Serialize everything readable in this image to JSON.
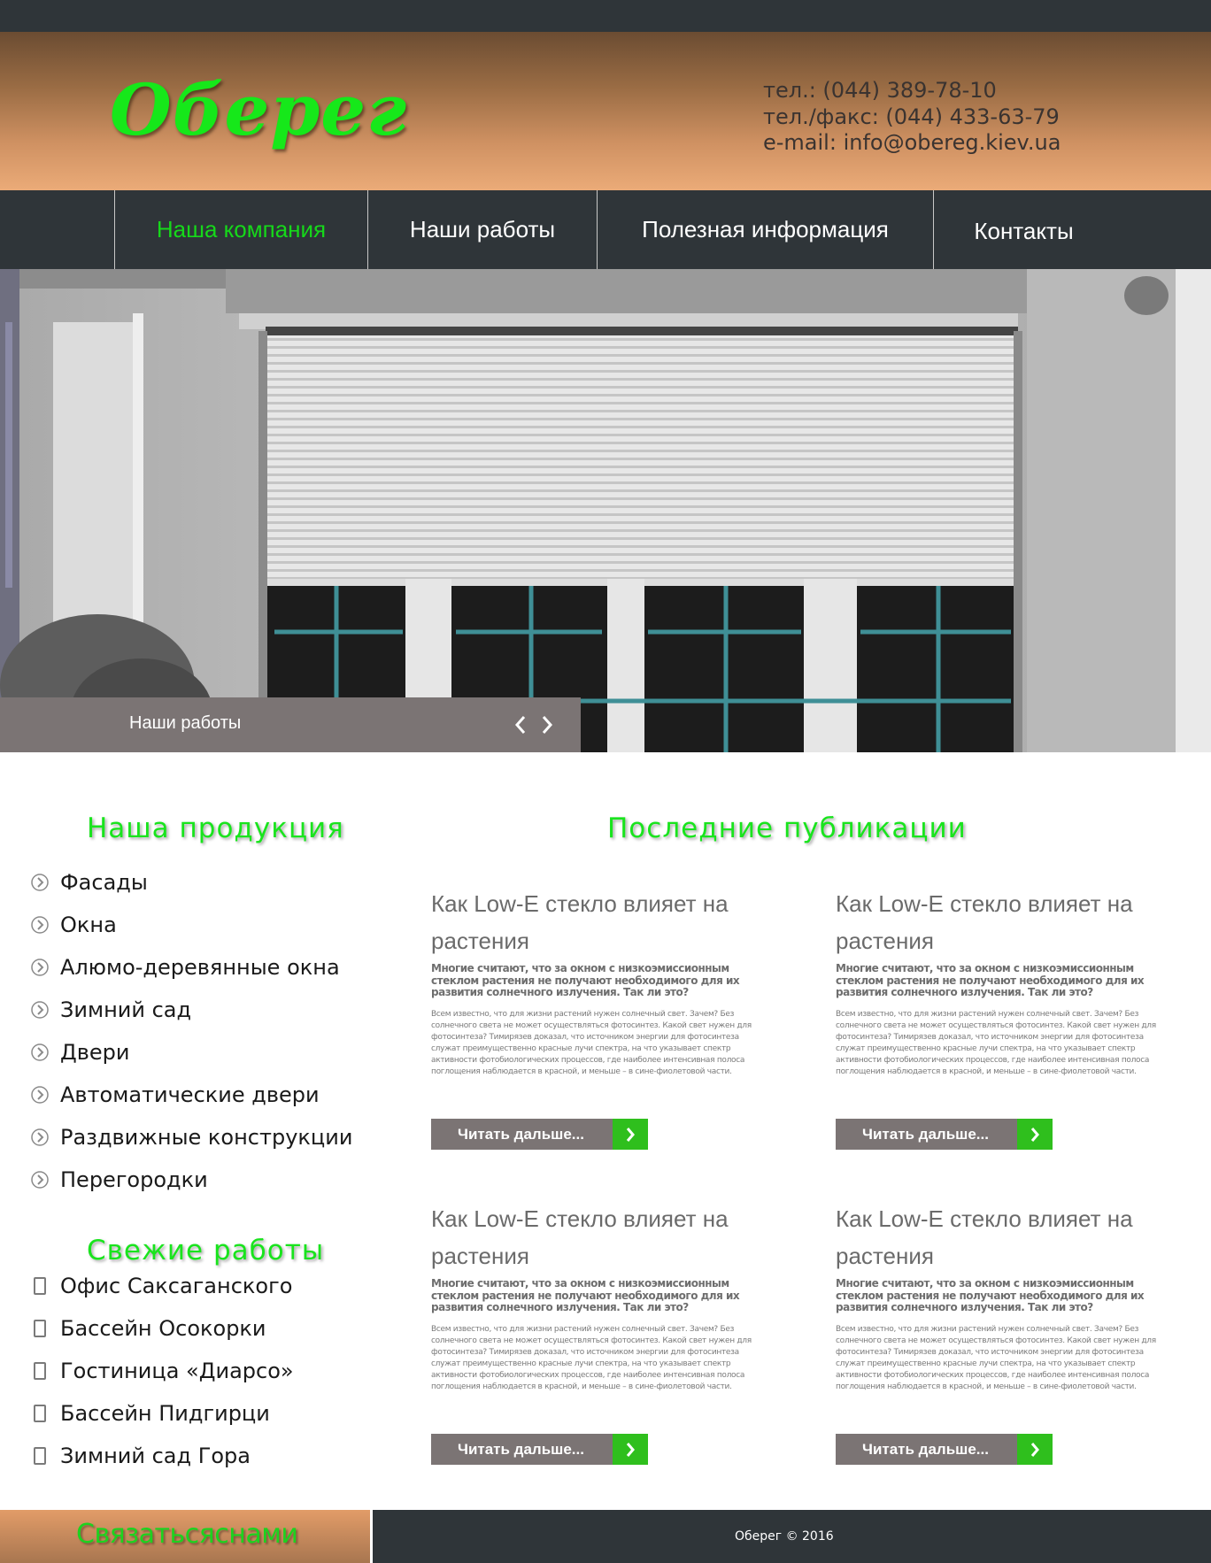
{
  "header": {
    "logo_text": "Оберег",
    "phone": "тел.: (044) 389-78-10",
    "fax": "тел./факс: (044) 433-63-79",
    "email": "e-mail: info@obereg.kiev.ua"
  },
  "nav": {
    "items": [
      {
        "label": "Наша компания",
        "active": true
      },
      {
        "label": "Наши работы",
        "active": false
      },
      {
        "label": "Полезная информация",
        "active": false
      },
      {
        "label": "Контакты",
        "active": false
      }
    ]
  },
  "slider": {
    "caption": "Наши работы",
    "prev_icon": "chevron-left-icon",
    "next_icon": "chevron-right-icon"
  },
  "products": {
    "title": "Наша продукция",
    "items": [
      "Фасады",
      "Окна",
      "Алюмо-деревянные окна",
      "Зимний сад",
      "Двери",
      "Автоматические двери",
      "Раздвижные конструкции",
      "Перегородки"
    ]
  },
  "recent_works": {
    "title": "Свежие работы",
    "items": [
      "Офис Саксаганского",
      "Бассейн Осокорки",
      "Гостиница «Диарсо»",
      "Бассейн Пидгирци",
      "Зимний сад Гора"
    ]
  },
  "publications": {
    "title": "Последние публикации",
    "posts": [
      {
        "title": "Как Low-E стекло влияет на растения",
        "lead": "Многие считают, что за окном с низкоэмиссионным стеклом растения не получают необходимого для их развития солнечного излучения. Так ли это?",
        "body": "Всем известно, что для жизни растений нужен солнечный свет. Зачем? Без солнечного света не может осуществляться фотосинтез. Какой свет нужен для фотосинтеза? Тимирязев доказал, что источником энергии для фотосинтеза служат преимущественно красные лучи спектра, на что указывает спектр активности фотобиологических процессов, где наиболее интенсивная полоса поглощения наблюдается в красной, и меньше – в сине-фиолетовой части.",
        "button": "Читать дальше..."
      },
      {
        "title": "Как Low-E стекло влияет на растения",
        "lead": "Многие считают, что за окном с низкоэмиссионным стеклом растения не получают необходимого для их развития солнечного излучения. Так ли это?",
        "body": "Всем известно, что для жизни растений нужен солнечный свет. Зачем? Без солнечного света не может осуществляться фотосинтез. Какой свет нужен для фотосинтеза? Тимирязев доказал, что источником энергии для фотосинтеза служат преимущественно красные лучи спектра, на что указывает спектр активности фотобиологических процессов, где наиболее интенсивная полоса поглощения наблюдается в красной, и меньше – в сине-фиолетовой части.",
        "button": "Читать дальше..."
      },
      {
        "title": "Как Low-E стекло влияет на растения",
        "lead": "Многие считают, что за окном с низкоэмиссионным стеклом растения не получают необходимого для их развития солнечного излучения. Так ли это?",
        "body": "Всем известно, что для жизни растений нужен солнечный свет. Зачем? Без солнечного света не может осуществляться фотосинтез. Какой свет нужен для фотосинтеза? Тимирязев доказал, что источником энергии для фотосинтеза служат преимущественно красные лучи спектра, на что указывает спектр активности фотобиологических процессов, где наиболее интенсивная полоса поглощения наблюдается в красной, и меньше – в сине-фиолетовой части.",
        "button": "Читать дальше..."
      },
      {
        "title": "Как Low-E стекло влияет на растения",
        "lead": "Многие считают, что за окном с низкоэмиссионным стеклом растения не получают необходимого для их развития солнечного излучения. Так ли это?",
        "body": "Всем известно, что для жизни растений нужен солнечный свет. Зачем? Без солнечного света не может осуществляться фотосинтез. Какой свет нужен для фотосинтеза? Тимирязев доказал, что источником энергии для фотосинтеза служат преимущественно красные лучи спектра, на что указывает спектр активности фотобиологических процессов, где наиболее интенсивная полоса поглощения наблюдается в красной, и меньше – в сине-фиолетовой части.",
        "button": "Читать дальше..."
      }
    ]
  },
  "footer": {
    "contact_cta": "Связатьсяснами",
    "copyright": "Оберег © 2016"
  },
  "colors": {
    "brand_green": "#16e81a",
    "dark_bar": "#2f3539",
    "button_gray": "#7b7474",
    "button_arrow_green": "#2fbf1d"
  }
}
